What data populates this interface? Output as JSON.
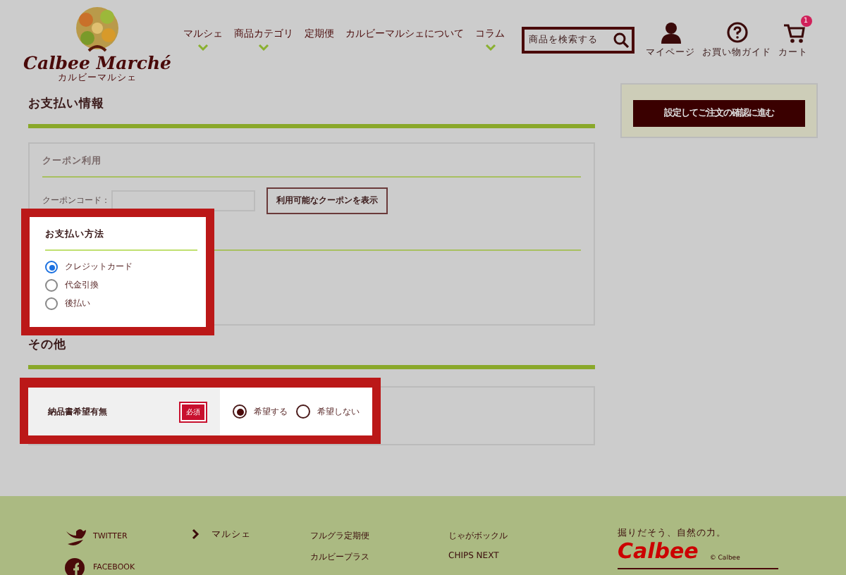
{
  "header": {
    "logo": {
      "name": "Calbee Marché",
      "sub": "カルビーマルシェ"
    },
    "nav": [
      {
        "label": "マルシェ",
        "dropdown": true
      },
      {
        "label": "商品カテゴリ",
        "dropdown": true
      },
      {
        "label": "定期便",
        "dropdown": false
      },
      {
        "label": "カルビーマルシェについて",
        "dropdown": false
      },
      {
        "label": "コラム",
        "dropdown": true
      }
    ],
    "search": {
      "placeholder": "商品を検索する"
    },
    "icons": [
      {
        "kind": "person",
        "label": "マイページ"
      },
      {
        "kind": "help",
        "label": "お買い物ガイド"
      },
      {
        "kind": "cart",
        "label": "カート",
        "badge": "1"
      }
    ]
  },
  "payment_info": {
    "title": "お支払い情報",
    "coupon": {
      "title": "クーポン利用",
      "code_label": "クーポンコード：",
      "button": "利用可能なクーポンを表示"
    },
    "method": {
      "title": "お支払い方法",
      "highlighted": true,
      "options": [
        {
          "label": "クレジットカード",
          "selected": true
        },
        {
          "label": "代金引換",
          "selected": false
        },
        {
          "label": "後払い",
          "selected": false
        }
      ]
    }
  },
  "other": {
    "title": "その他",
    "rows": [
      {
        "label": "納品書希望有無",
        "badge": "必須",
        "highlighted": true,
        "options": [
          {
            "label": "希望する",
            "selected": true
          },
          {
            "label": "希望しない",
            "selected": false
          }
        ]
      }
    ]
  },
  "confirm_button": "設定してご注文の確認に進む",
  "footer": {
    "social": [
      "TWITTER",
      "FACEBOOK"
    ],
    "section": "マルシェ",
    "links_1": [
      "フルグラ定期便",
      "カルビープラス"
    ],
    "links_2": [
      "じゃがボックル",
      "CHIPS NEXT"
    ],
    "brand": {
      "tagline": "掘りだそう、自然の力。",
      "logo": "Calbee",
      "copyright": "© Calbee"
    }
  }
}
